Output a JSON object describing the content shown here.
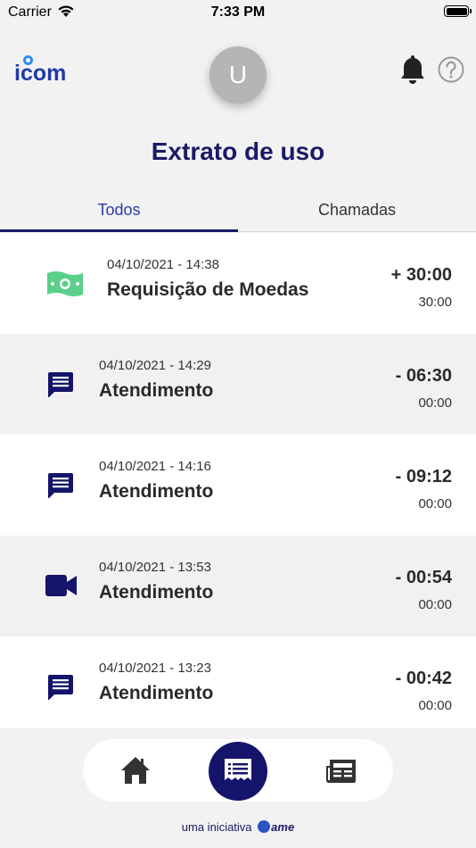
{
  "status_bar": {
    "carrier": "Carrier",
    "time": "7:33 PM"
  },
  "header": {
    "logo_text": "icom",
    "avatar_initial": "U"
  },
  "page": {
    "title": "Extrato de uso"
  },
  "tabs": [
    {
      "label": "Todos",
      "active": true
    },
    {
      "label": "Chamadas",
      "active": false
    }
  ],
  "transactions": [
    {
      "icon": "money-icon",
      "date": "04/10/2021 - 14:38",
      "label": "Requisição de Moedas",
      "amount": "+ 30:00",
      "balance": "30:00"
    },
    {
      "icon": "chat-icon",
      "date": "04/10/2021 - 14:29",
      "label": "Atendimento",
      "amount": "- 06:30",
      "balance": "00:00"
    },
    {
      "icon": "chat-icon",
      "date": "04/10/2021 - 14:16",
      "label": "Atendimento",
      "amount": "- 09:12",
      "balance": "00:00"
    },
    {
      "icon": "video-icon",
      "date": "04/10/2021 - 13:53",
      "label": "Atendimento",
      "amount": "- 00:54",
      "balance": "00:00"
    },
    {
      "icon": "chat-icon",
      "date": "04/10/2021 - 13:23",
      "label": "Atendimento",
      "amount": "- 00:42",
      "balance": "00:00"
    }
  ],
  "footer": {
    "prefix": "uma iniciativa",
    "brand": "ame"
  },
  "colors": {
    "navy": "#15146b",
    "tab_active": "#2b3aa8",
    "money_green": "#5ad08a",
    "logo_blue": "#1f3aa8"
  }
}
